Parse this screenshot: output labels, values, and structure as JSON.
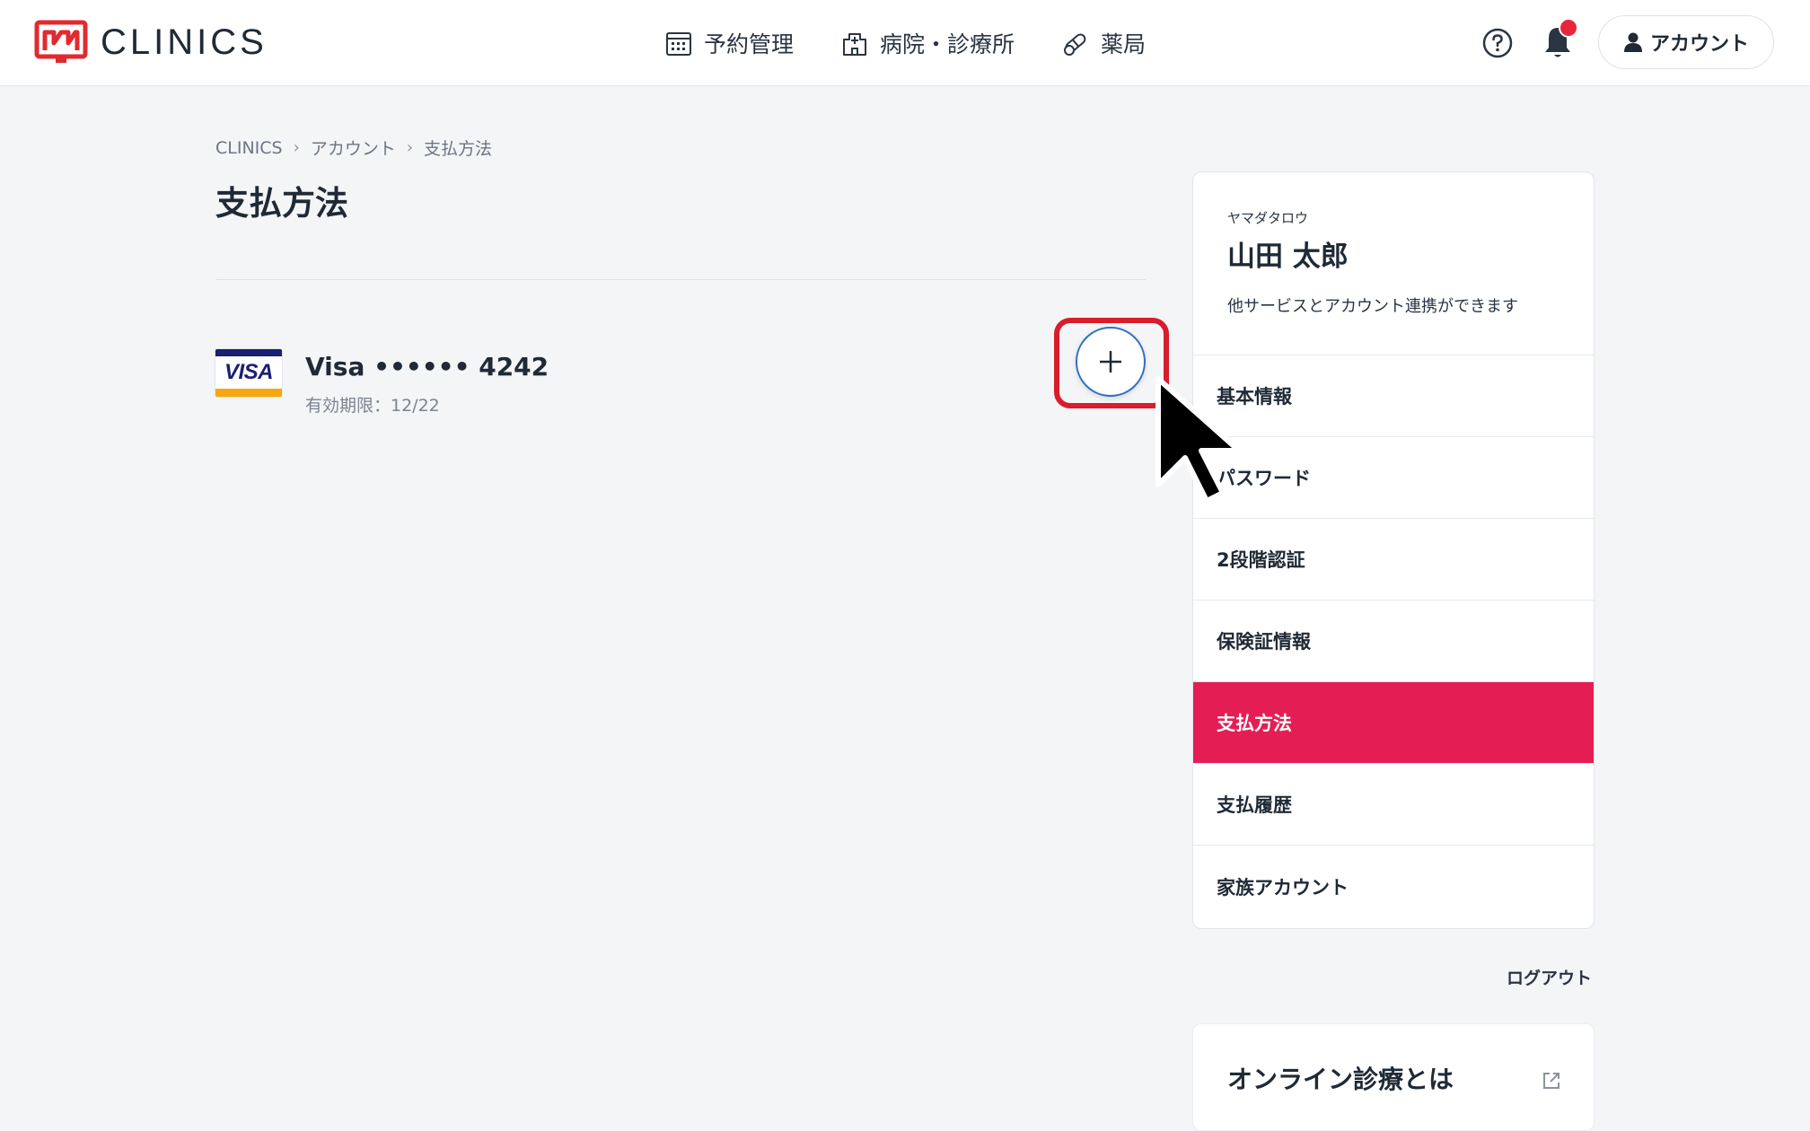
{
  "brand": {
    "name": "CLINICS",
    "accent": "#e41e54",
    "logo_red": "#e12a2f"
  },
  "nav": [
    {
      "label": "予約管理",
      "icon": "calendar-icon"
    },
    {
      "label": "病院・診療所",
      "icon": "hospital-icon"
    },
    {
      "label": "薬局",
      "icon": "pill-icon"
    }
  ],
  "header": {
    "help_icon": "help-circle-icon",
    "bell_icon": "bell-icon",
    "account_label": "アカウント"
  },
  "breadcrumb": [
    "CLINICS",
    "アカウント",
    "支払方法"
  ],
  "page_title": "支払方法",
  "card": {
    "brand": "VISA",
    "name": "Visa •••••• 4242",
    "expiry": "有効期限：12/22"
  },
  "add_button_icon": "plus-icon",
  "profile": {
    "kana": "ヤマダタロウ",
    "name": "山田 太郎",
    "note": "他サービスとアカウント連携ができます"
  },
  "menu": [
    {
      "label": "基本情報",
      "active": false
    },
    {
      "label": "パスワード",
      "active": false
    },
    {
      "label": "2段階認証",
      "active": false
    },
    {
      "label": "保険証情報",
      "active": false
    },
    {
      "label": "支払方法",
      "active": true
    },
    {
      "label": "支払履歴",
      "active": false
    },
    {
      "label": "家族アカウント",
      "active": false
    }
  ],
  "logout_label": "ログアウト",
  "promo": {
    "title": "オンライン診療とは",
    "icon": "external-link-icon"
  }
}
